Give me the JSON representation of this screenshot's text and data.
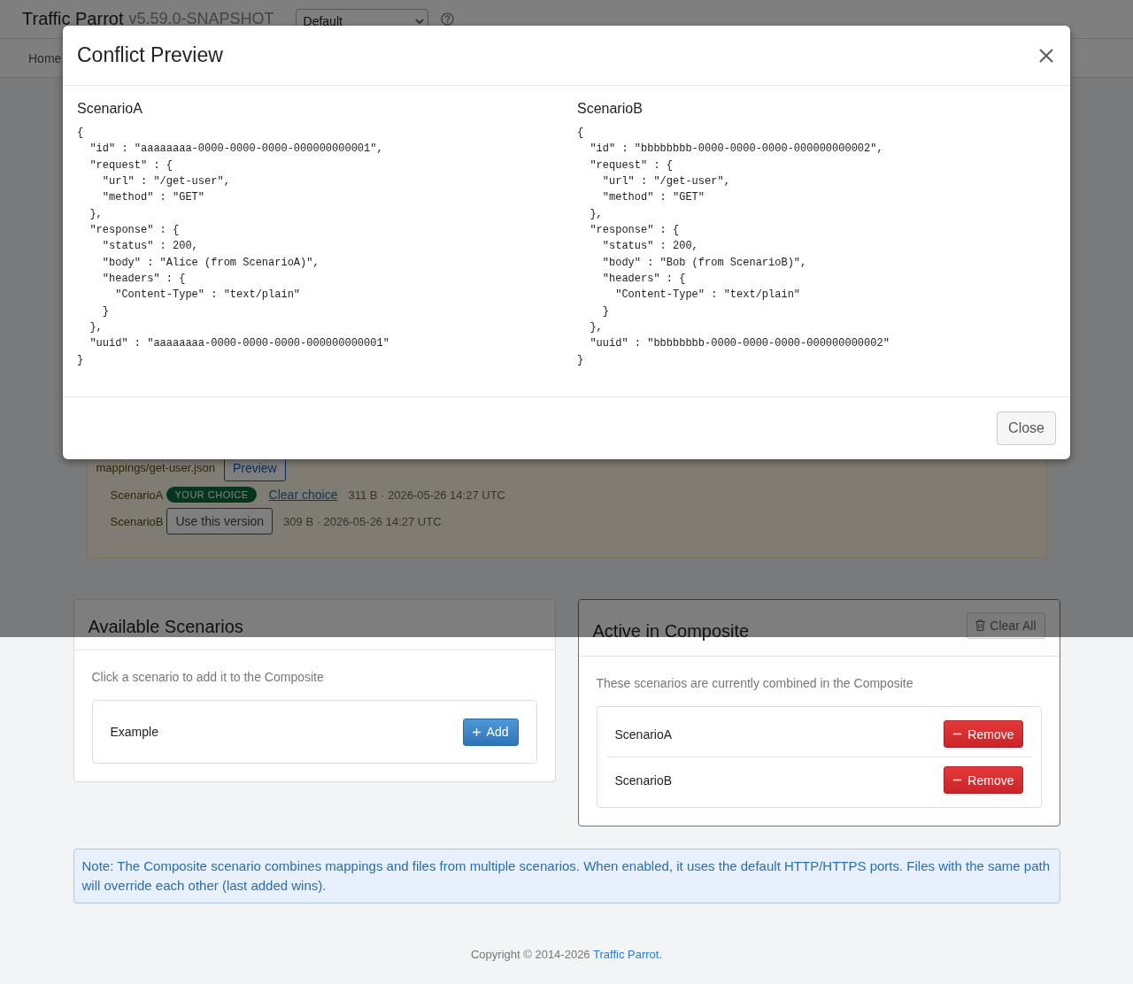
{
  "header": {
    "brand": "Traffic Parrot",
    "version": "v5.59.0-SNAPSHOT",
    "environment": "Default"
  },
  "nav_items": [
    "Home"
  ],
  "conflict": {
    "file": "mappings/get-user.json",
    "preview_button": "Preview",
    "versions": [
      {
        "scenario": "ScenarioA",
        "selected": true,
        "badge": "YOUR CHOICE",
        "action": "Clear choice",
        "meta": "311 B · 2026-05-26 14:27 UTC"
      },
      {
        "scenario": "ScenarioB",
        "selected": false,
        "action": "Use this version",
        "meta": "309 B · 2026-05-26 14:27 UTC"
      }
    ]
  },
  "available": {
    "title": "Available Scenarios",
    "hint": "Click a scenario to add it to the Composite",
    "scenarios": [
      {
        "name": "Example",
        "action": "Add"
      }
    ]
  },
  "active": {
    "title": "Active in Composite",
    "clear_button": "Clear All",
    "hint": "These scenarios are currently combined in the Composite",
    "scenarios": [
      {
        "name": "ScenarioA",
        "action": "Remove"
      },
      {
        "name": "ScenarioB",
        "action": "Remove"
      }
    ]
  },
  "note": "Note: The Composite scenario combines mappings and files from multiple scenarios. When enabled, it uses the default HTTP/HTTPS ports. Files with the same path will override each other (last added wins).",
  "footer": {
    "copyright": "Copyright © 2014-2026",
    "link": "Traffic Parrot."
  },
  "modal": {
    "open": true,
    "title": "Conflict Preview",
    "close_button": "Close",
    "columns": [
      {
        "title": "ScenarioA",
        "code": "{\n  \"id\" : \"aaaaaaaa-0000-0000-0000-000000000001\",\n  \"request\" : {\n    \"url\" : \"/get-user\",\n    \"method\" : \"GET\"\n  },\n  \"response\" : {\n    \"status\" : 200,\n    \"body\" : \"Alice (from ScenarioA)\",\n    \"headers\" : {\n      \"Content-Type\" : \"text/plain\"\n    }\n  },\n  \"uuid\" : \"aaaaaaaa-0000-0000-0000-000000000001\"\n}"
      },
      {
        "title": "ScenarioB",
        "code": "{\n  \"id\" : \"bbbbbbbb-0000-0000-0000-000000000002\",\n  \"request\" : {\n    \"url\" : \"/get-user\",\n    \"method\" : \"GET\"\n  },\n  \"response\" : {\n    \"status\" : 200,\n    \"body\" : \"Bob (from ScenarioB)\",\n    \"headers\" : {\n      \"Content-Type\" : \"text/plain\"\n    }\n  },\n  \"uuid\" : \"bbbbbbbb-0000-0000-0000-000000000002\"\n}"
      }
    ]
  }
}
